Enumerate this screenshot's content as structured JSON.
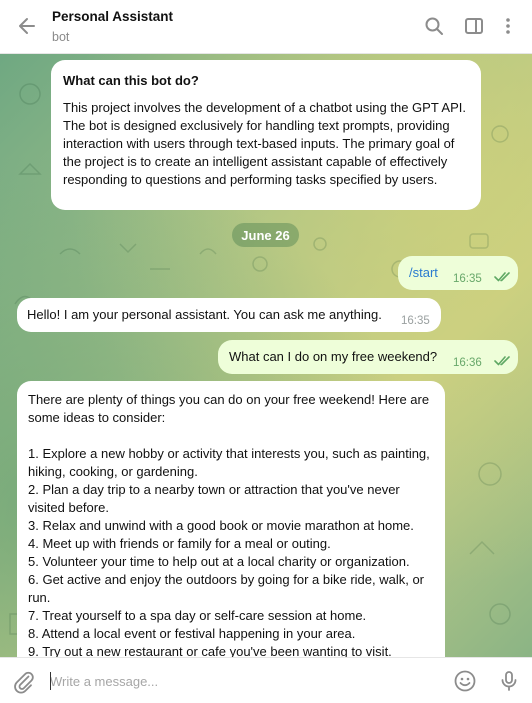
{
  "header": {
    "title": "Personal Assistant",
    "subtitle": "bot"
  },
  "bot_info": {
    "title": "What can this bot do?",
    "description": "This project involves the development of a chatbot using the GPT API. The bot is designed exclusively for handling text prompts, providing interaction with users through text-based inputs. The primary goal of the project is to create an intelligent assistant capable of effectively responding to questions and performing tasks specified by users."
  },
  "date_separator": "June 26",
  "messages": [
    {
      "direction": "out",
      "text": "/start",
      "time": "16:35"
    },
    {
      "direction": "in",
      "text": "Hello! I am your personal assistant. You can ask me anything.",
      "time": "16:35"
    },
    {
      "direction": "out",
      "text": "What can I do on my free weekend?",
      "time": "16:36"
    }
  ],
  "long_reply": {
    "intro": "There are plenty of things you can do on your free weekend! Here are some ideas to consider:",
    "items": [
      "1. Explore a new hobby or activity that interests you, such as painting, hiking, cooking, or gardening.",
      "2. Plan a day trip to a nearby town or attraction that you've never visited before.",
      "3. Relax and unwind with a good book or movie marathon at home.",
      "4. Meet up with friends or family for a meal or outing.",
      "5. Volunteer your time to help out at a local charity or organization.",
      "6. Get active and enjoy the outdoors by going for a bike ride, walk, or run.",
      "7. Treat yourself to a spa day or self-care session at home.",
      "8. Attend a local event or festival happening in your area.",
      "9. Try out a new restaurant or cafe you've been wanting to visit."
    ]
  },
  "composer": {
    "placeholder": "Write a message..."
  },
  "colors": {
    "outgoing_bubble": "#eefed9",
    "incoming_bubble": "#ffffff",
    "command_link": "#2a7bd0",
    "read_ticks": "#5fa864"
  },
  "icons": [
    "back-arrow-icon",
    "search-icon",
    "sidebar-toggle-icon",
    "more-vertical-icon",
    "paperclip-icon",
    "emoji-icon",
    "microphone-icon",
    "double-check-icon"
  ]
}
